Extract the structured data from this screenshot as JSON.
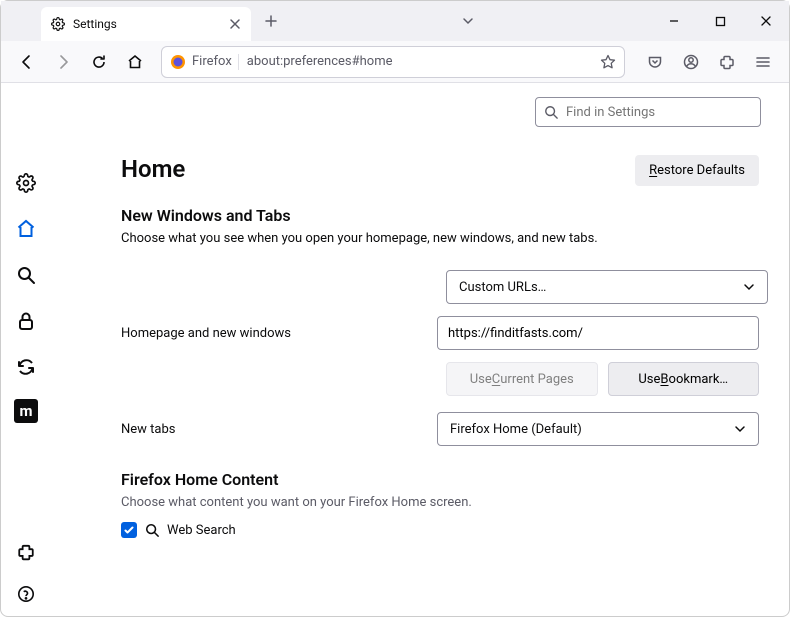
{
  "tab": {
    "title": "Settings"
  },
  "toolbar": {
    "identity": "Firefox",
    "url": "about:preferences#home"
  },
  "search": {
    "placeholder": "Find in Settings"
  },
  "page": {
    "title": "Home"
  },
  "buttons": {
    "restore": "Restore Defaults",
    "useCurrent": "Use Current Pages",
    "useBookmark": "Use Bookmark…"
  },
  "section1": {
    "title": "New Windows and Tabs",
    "desc": "Choose what you see when you open your homepage, new windows, and new tabs.",
    "homepageLabel": "Homepage and new windows",
    "homepageSelect": "Custom URLs…",
    "homepageUrl": "https://finditfasts.com/",
    "newtabsLabel": "New tabs",
    "newtabsSelect": "Firefox Home (Default)"
  },
  "section2": {
    "title": "Firefox Home Content",
    "desc": "Choose what content you want on your Firefox Home screen.",
    "websearch": "Web Search"
  }
}
